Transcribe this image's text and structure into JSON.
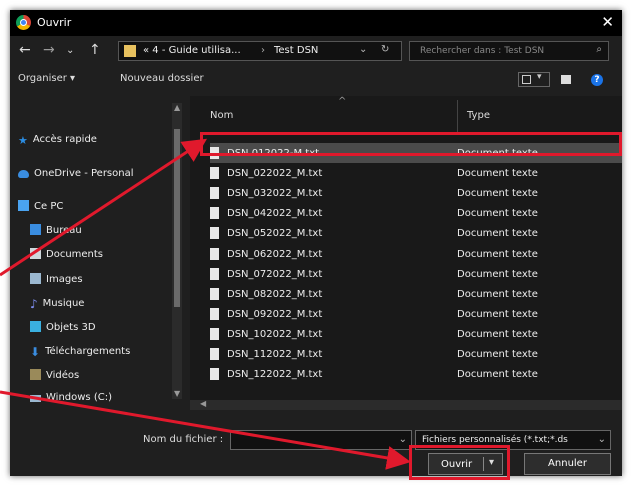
{
  "window": {
    "title": "Ouvrir",
    "close_glyph": "✕"
  },
  "nav": {
    "back": "←",
    "forward": "→",
    "up": "↑"
  },
  "address": {
    "crumb1": "«  4 - Guide utilisa...",
    "sep": "›",
    "crumb2": "Test DSN",
    "dropdown": "⌄",
    "refresh": "↻"
  },
  "search": {
    "placeholder": "Rechercher dans : Test DSN",
    "icon": "⌕"
  },
  "toolbar": {
    "organize": "Organiser ▾",
    "new_folder": "Nouveau dossier",
    "help": "?"
  },
  "sidebar": {
    "items": [
      {
        "label": "Accès rapide",
        "icon": "star-icon",
        "color": "#2b8de3"
      },
      {
        "label": "OneDrive - Personal",
        "icon": "cloud-icon",
        "color": "#3a8de0"
      },
      {
        "label": "Ce PC",
        "icon": "computer-icon",
        "color": "#4aa3f0"
      },
      {
        "label": "Bureau",
        "icon": "desktop-icon",
        "color": "#3a8de0"
      },
      {
        "label": "Documents",
        "icon": "documents-icon",
        "color": "#cfd8dc"
      },
      {
        "label": "Images",
        "icon": "images-icon",
        "color": "#9bb8d0"
      },
      {
        "label": "Musique",
        "icon": "music-icon",
        "color": "#7e8df0"
      },
      {
        "label": "Objets 3D",
        "icon": "cube-icon",
        "color": "#3ab0e0"
      },
      {
        "label": "Téléchargements",
        "icon": "download-icon",
        "color": "#3a8de0"
      },
      {
        "label": "Vidéos",
        "icon": "video-icon",
        "color": "#9a8a5a"
      },
      {
        "label": "Windows (C:)",
        "icon": "drive-icon",
        "color": "#9bb8d0"
      }
    ]
  },
  "columns": {
    "name": "Nom",
    "type": "Type"
  },
  "files": [
    {
      "name": "DSN 012022-M.txt",
      "type": "Document texte",
      "selected": true
    },
    {
      "name": "DSN_022022_M.txt",
      "type": "Document texte"
    },
    {
      "name": "DSN_032022_M.txt",
      "type": "Document texte"
    },
    {
      "name": "DSN_042022_M.txt",
      "type": "Document texte"
    },
    {
      "name": "DSN_052022_M.txt",
      "type": "Document texte"
    },
    {
      "name": "DSN_062022_M.txt",
      "type": "Document texte"
    },
    {
      "name": "DSN_072022_M.txt",
      "type": "Document texte"
    },
    {
      "name": "DSN_082022_M.txt",
      "type": "Document texte"
    },
    {
      "name": "DSN_092022_M.txt",
      "type": "Document texte"
    },
    {
      "name": "DSN_102022_M.txt",
      "type": "Document texte"
    },
    {
      "name": "DSN_112022_M.txt",
      "type": "Document texte"
    },
    {
      "name": "DSN_122022_M.txt",
      "type": "Document texte"
    }
  ],
  "bottom": {
    "filename_label": "Nom du fichier :",
    "filename_value": "",
    "filter": "Fichiers personnalisés (*.txt;*.ds",
    "open": "Ouvrir",
    "cancel": "Annuler"
  },
  "colors": {
    "annotation_red": "#e0192c",
    "selection": "#4b4b4b"
  }
}
